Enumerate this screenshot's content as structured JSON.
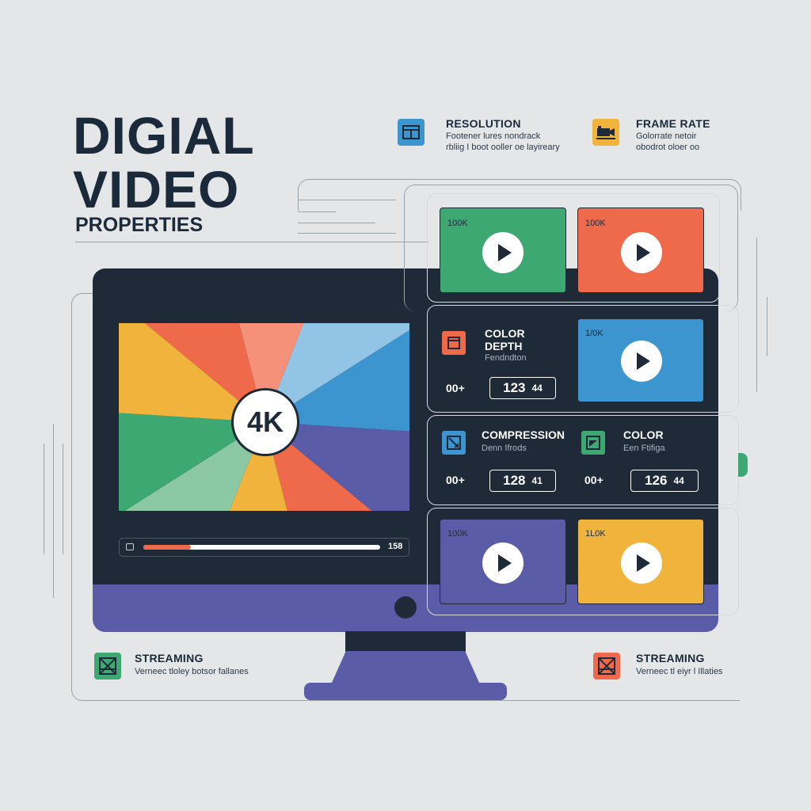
{
  "title": {
    "line1": "DIGIAL",
    "line2": "VIDEO",
    "line3": "PROPERTIES"
  },
  "legend": {
    "resolution": {
      "title": "RESOLUTION",
      "desc1": "Footener lures nondrack",
      "desc2": "rbliig I boot ooller oe layireary",
      "icon": "window-icon",
      "color": "#3d95d0"
    },
    "frame_rate": {
      "title": "FRAME RATE",
      "desc1": "Golorrate netoir",
      "desc2": "obodrot oloer oo",
      "icon": "frame-icon",
      "color": "#f0b43d"
    }
  },
  "player": {
    "badge": "4K",
    "time": "158",
    "progress": 0.2,
    "colors": [
      "#ef6a4b",
      "#f59178",
      "#92c4e6",
      "#3d95d0",
      "#5a5ca8",
      "#ef6a4b",
      "#f0b43d",
      "#8dc8a4",
      "#3ea872",
      "#f0b43d"
    ]
  },
  "thumbnails": [
    {
      "label": "100K",
      "color": "#3ea872"
    },
    {
      "label": "100K",
      "color": "#ef6a4b"
    },
    {
      "label": "1/0K",
      "color": "#3d95d0"
    },
    {
      "label": "100K",
      "color": "#5a5ca8"
    },
    {
      "label": "1L0K",
      "color": "#f0b43d"
    }
  ],
  "properties": {
    "color_depth": {
      "title1": "COLOR",
      "title2": "DEPTH",
      "sub": "Fendndton",
      "left": "00+",
      "value": "123",
      "unit": "44",
      "icon": "box-icon",
      "color": "#ef6a4b"
    },
    "compression": {
      "title": "COMPRESSION",
      "sub": "Denn Ifrods",
      "left": "00+",
      "value": "128",
      "unit": "41",
      "icon": "compress-icon",
      "color": "#3d95d0"
    },
    "color": {
      "title": "COLOR",
      "sub": "Een Ftifiga",
      "left": "00+",
      "value": "126",
      "unit": "44",
      "icon": "image-icon",
      "color": "#3ea872"
    }
  },
  "streaming": [
    {
      "title": "STREAMING",
      "desc": "Verneec tloley botsor fallanes",
      "icon": "streaming-icon",
      "color": "#3ea872"
    },
    {
      "title": "STREAMING",
      "desc": "Verneec tl eiyr l Illaties",
      "icon": "streaming-icon",
      "color": "#ef6a4b"
    }
  ]
}
